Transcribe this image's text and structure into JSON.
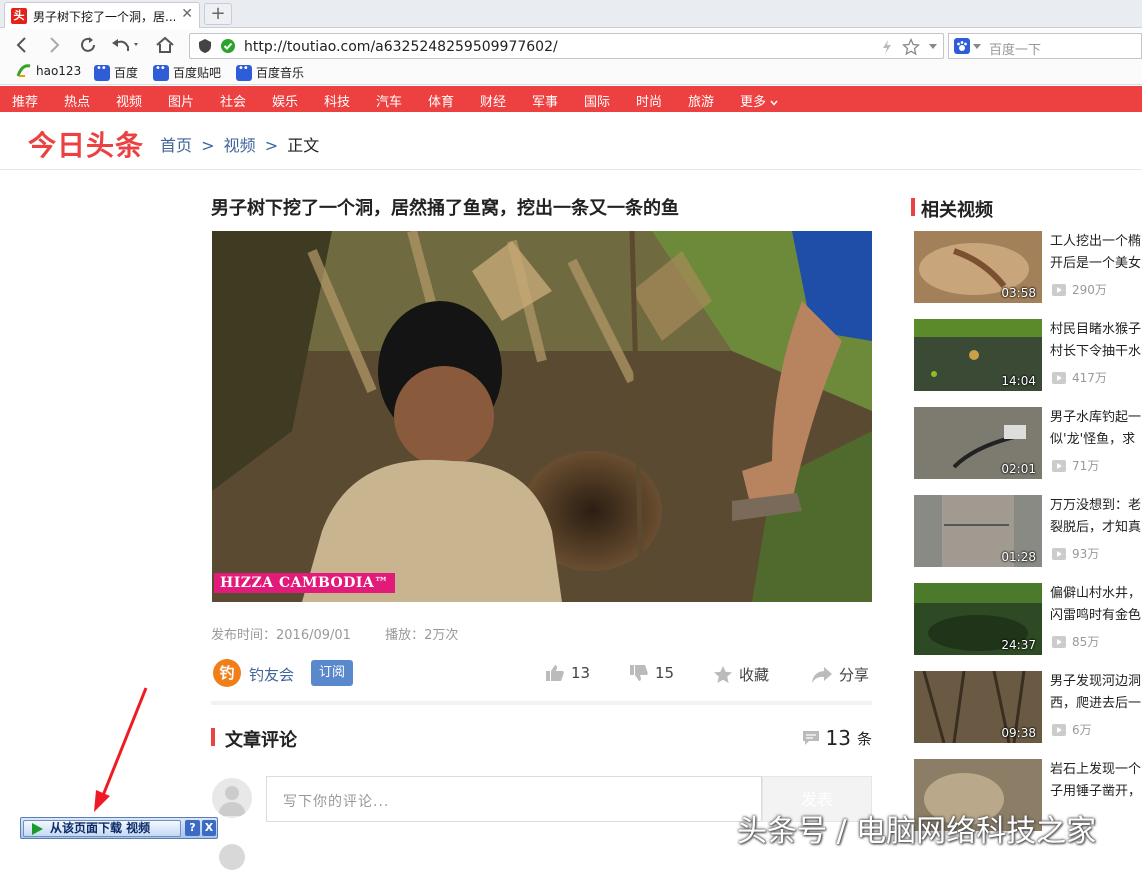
{
  "browser": {
    "tab_title": "男子树下挖了一个洞，居...",
    "tab_favicon_text": "头",
    "url": "http://toutiao.com/a6325248259509977602/",
    "search_placeholder": "百度一下",
    "bookmarks": [
      "hao123",
      "百度",
      "百度贴吧",
      "百度音乐"
    ]
  },
  "categories": [
    "推荐",
    "热点",
    "视频",
    "图片",
    "社会",
    "娱乐",
    "科技",
    "汽车",
    "体育",
    "财经",
    "军事",
    "国际",
    "时尚",
    "旅游",
    "更多"
  ],
  "header": {
    "logo": "今日头条",
    "breadcrumb": [
      "首页",
      "视频",
      "正文"
    ],
    "breadcrumb_sep": ">"
  },
  "article": {
    "title": "男子树下挖了一个洞，居然捅了鱼窝，挖出一条又一条的鱼",
    "video_watermark": "HIZZA CAMBODIA™",
    "publish": "发布时间：2016/09/01",
    "plays": "播放：2万次",
    "author": {
      "avatar_text": "钓",
      "name": "钓友会",
      "subscribe": "订阅"
    },
    "likes": "13",
    "dislikes": "15",
    "favorite": "收藏",
    "share": "分享"
  },
  "comments": {
    "title": "文章评论",
    "count": "13",
    "count_unit": "条",
    "placeholder": "写下你的评论...",
    "submit": "发表"
  },
  "sidebar": {
    "title": "相关视频",
    "videos": [
      {
        "title": "工人挖出一个椭开后是一个美女",
        "duration": "03:58",
        "plays": "290万"
      },
      {
        "title": "村民目睹水猴子村长下令抽干水",
        "duration": "14:04",
        "plays": "417万"
      },
      {
        "title": "男子水库钓起一似'龙'怪鱼，求",
        "duration": "02:01",
        "plays": "71万"
      },
      {
        "title": "万万没想到：老裂脱后，才知真",
        "duration": "01:28",
        "plays": "93万"
      },
      {
        "title": "偏僻山村水井，闪雷鸣时有金色",
        "duration": "24:37",
        "plays": "85万"
      },
      {
        "title": "男子发现河边洞西，爬进去后一",
        "duration": "09:38",
        "plays": "6万"
      },
      {
        "title": "岩石上发现一个子用锤子凿开，",
        "duration": "",
        "plays": ""
      }
    ]
  },
  "overlay": {
    "download_label": "从该页面下载 视频",
    "help": "?",
    "close": "X",
    "watermark": "头条号 / 电脑网络科技之家"
  },
  "colors": {
    "brand_red": "#ed4040",
    "link_blue": "#406599",
    "subscribe_blue": "#5a88cc"
  }
}
